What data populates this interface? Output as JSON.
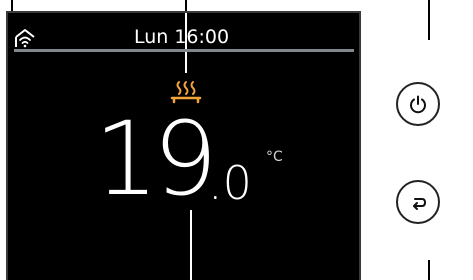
{
  "status": {
    "day": "Lun",
    "time": "16:00"
  },
  "temperature": {
    "integer": "19",
    "decimal": ".0",
    "unit": "°C"
  },
  "icons": {
    "wifi": "wifi-home-icon",
    "heating": "heating-icon",
    "power": "power-icon",
    "back": "back-arrow-icon"
  },
  "colors": {
    "screen_background": "#000000",
    "text": "#ffffff",
    "divider": "#7f868c",
    "heating_accent": "#f2a33a"
  }
}
